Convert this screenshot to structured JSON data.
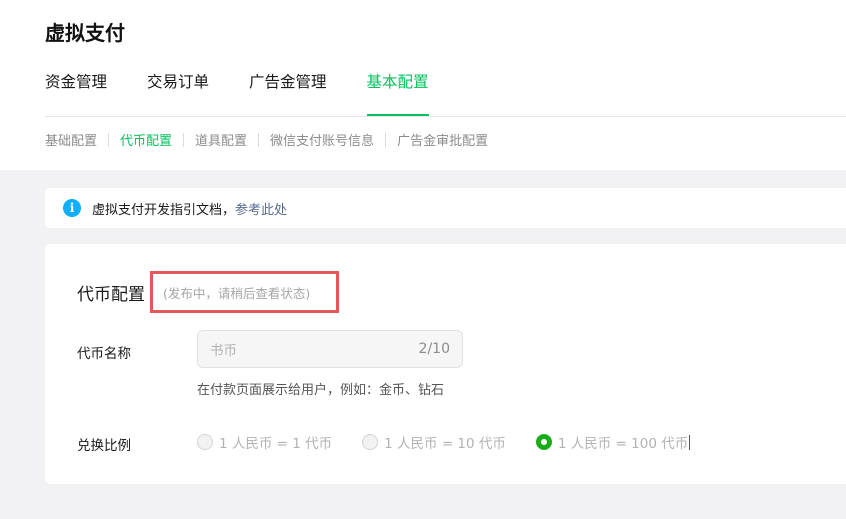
{
  "page": {
    "title": "虚拟支付"
  },
  "main_tabs": [
    {
      "label": "资金管理",
      "active": false
    },
    {
      "label": "交易订单",
      "active": false
    },
    {
      "label": "广告金管理",
      "active": false
    },
    {
      "label": "基本配置",
      "active": true
    }
  ],
  "sub_tabs": [
    {
      "label": "基础配置",
      "active": false
    },
    {
      "label": "代币配置",
      "active": true
    },
    {
      "label": "道具配置",
      "active": false
    },
    {
      "label": "微信支付账号信息",
      "active": false
    },
    {
      "label": "广告金审批配置",
      "active": false
    }
  ],
  "notice": {
    "icon": "info-icon",
    "text": "虚拟支付开发指引文档，",
    "link": "参考此处"
  },
  "card": {
    "title": "代币配置",
    "status": "(发布中，请稍后查看状态)",
    "name_field": {
      "label": "代币名称",
      "value": "书币",
      "count": "2/10",
      "hint": "在付款页面展示给用户，例如：金币、钻石"
    },
    "ratio_field": {
      "label": "兑换比例",
      "options": [
        {
          "label": "1 人民币 = 1 代币",
          "checked": false
        },
        {
          "label": "1 人民币 = 10 代币",
          "checked": false
        },
        {
          "label": "1 人民币 = 100 代币",
          "checked": true
        }
      ]
    }
  },
  "colors": {
    "accent": "#07c160",
    "link": "#576b95",
    "highlight_border": "#e05a5a",
    "info": "#10aeff"
  }
}
